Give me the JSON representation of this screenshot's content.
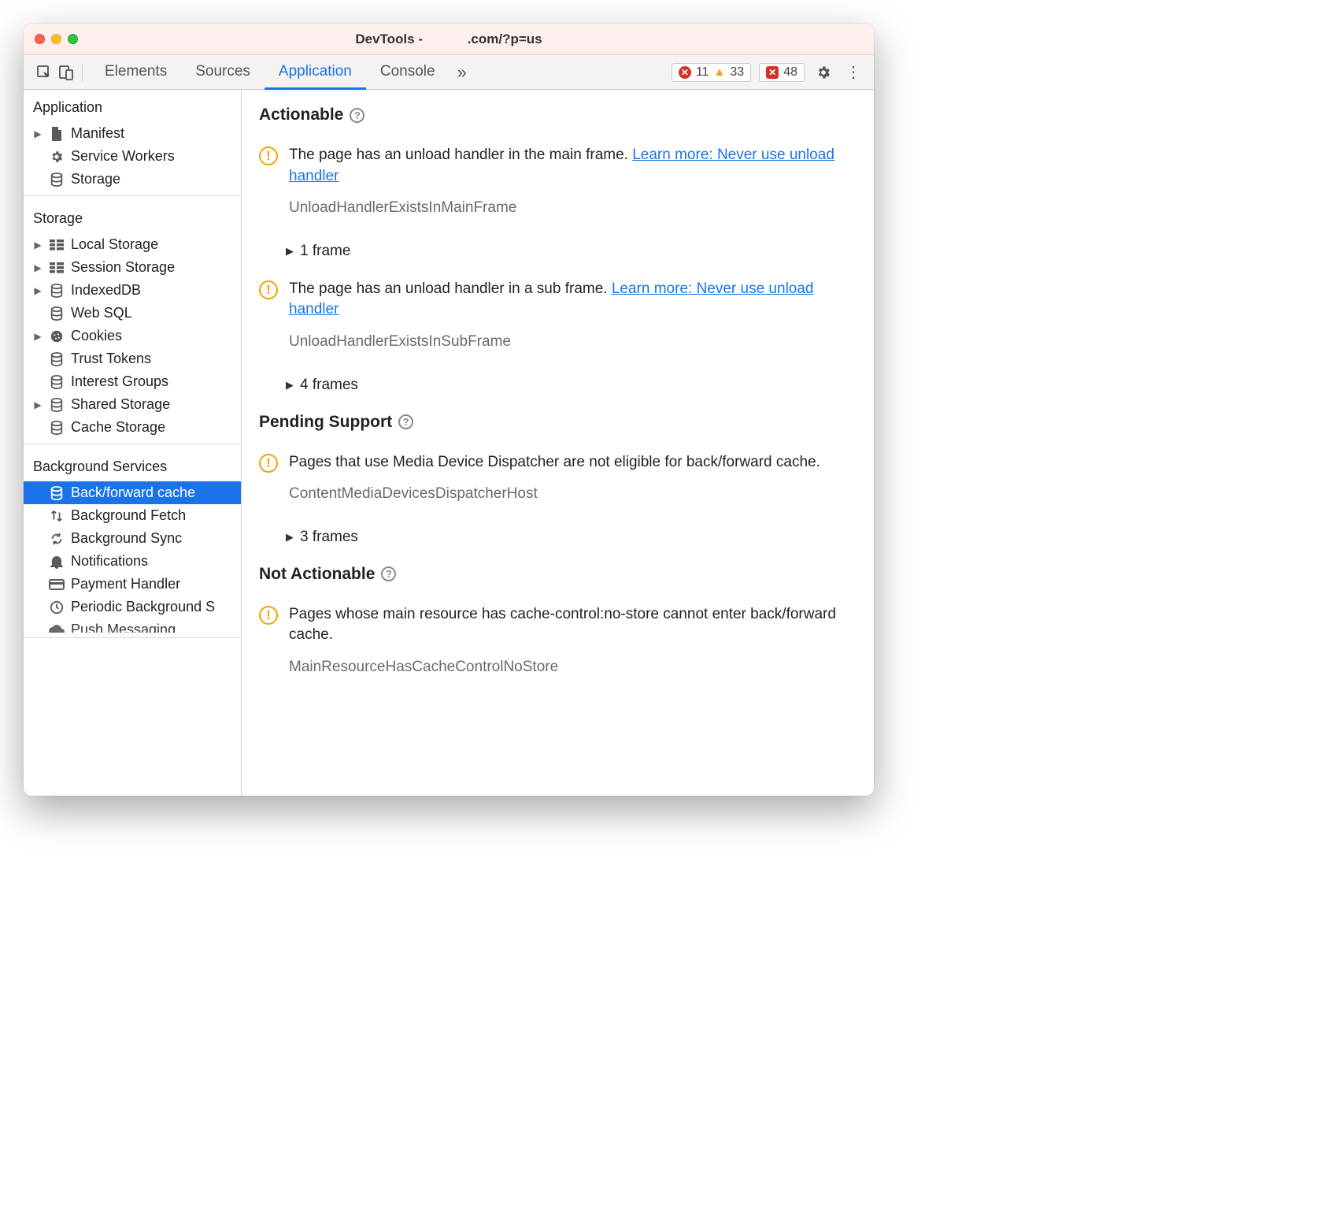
{
  "window": {
    "title_prefix": "DevTools -",
    "title_suffix": ".com/?p=us"
  },
  "toolbar": {
    "tabs": [
      "Elements",
      "Sources",
      "Application",
      "Console"
    ],
    "active_index": 2,
    "errors": "11",
    "warnings": "33",
    "issues": "48"
  },
  "sidebar": {
    "sections": [
      {
        "label": "Application",
        "items": [
          {
            "label": "Manifest",
            "icon": "file",
            "caret": true
          },
          {
            "label": "Service Workers",
            "icon": "gear",
            "caret": false
          },
          {
            "label": "Storage",
            "icon": "db",
            "caret": false
          }
        ]
      },
      {
        "label": "Storage",
        "items": [
          {
            "label": "Local Storage",
            "icon": "grid",
            "caret": true
          },
          {
            "label": "Session Storage",
            "icon": "grid",
            "caret": true
          },
          {
            "label": "IndexedDB",
            "icon": "db",
            "caret": true
          },
          {
            "label": "Web SQL",
            "icon": "db",
            "caret": false
          },
          {
            "label": "Cookies",
            "icon": "cookie",
            "caret": true
          },
          {
            "label": "Trust Tokens",
            "icon": "db",
            "caret": false
          },
          {
            "label": "Interest Groups",
            "icon": "db",
            "caret": false
          },
          {
            "label": "Shared Storage",
            "icon": "db",
            "caret": true
          },
          {
            "label": "Cache Storage",
            "icon": "db",
            "caret": false
          }
        ]
      },
      {
        "label": "Background Services",
        "items": [
          {
            "label": "Back/forward cache",
            "icon": "db",
            "caret": false,
            "selected": true
          },
          {
            "label": "Background Fetch",
            "icon": "updown",
            "caret": false
          },
          {
            "label": "Background Sync",
            "icon": "sync",
            "caret": false
          },
          {
            "label": "Notifications",
            "icon": "bell",
            "caret": false
          },
          {
            "label": "Payment Handler",
            "icon": "card",
            "caret": false
          },
          {
            "label": "Periodic Background Sync",
            "icon": "clock",
            "caret": false,
            "truncated": true
          },
          {
            "label": "Push Messaging",
            "icon": "cloud",
            "caret": false,
            "cut": true
          }
        ]
      }
    ]
  },
  "main": {
    "sections": [
      {
        "title": "Actionable",
        "issues": [
          {
            "message": "The page has an unload handler in the main frame. ",
            "link": "Learn more: Never use unload handler",
            "code": "UnloadHandlerExistsInMainFrame",
            "frames": "1 frame"
          },
          {
            "message": "The page has an unload handler in a sub frame. ",
            "link": "Learn more: Never use unload handler",
            "code": "UnloadHandlerExistsInSubFrame",
            "frames": "4 frames"
          }
        ]
      },
      {
        "title": "Pending Support",
        "issues": [
          {
            "message": "Pages that use Media Device Dispatcher are not eligible for back/forward cache.",
            "code": "ContentMediaDevicesDispatcherHost",
            "frames": "3 frames"
          }
        ]
      },
      {
        "title": "Not Actionable",
        "issues": [
          {
            "message": "Pages whose main resource has cache-control:no-store cannot enter back/forward cache.",
            "code": "MainResourceHasCacheControlNoStore"
          }
        ]
      }
    ]
  }
}
